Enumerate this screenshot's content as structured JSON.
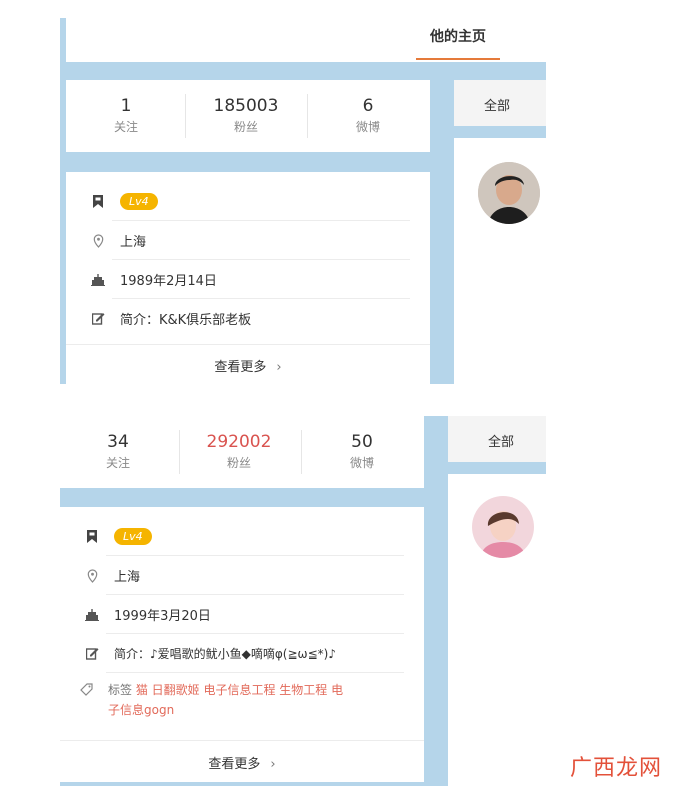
{
  "header": {
    "tab_home": "他的主页"
  },
  "profile1": {
    "stats": [
      {
        "num": "1",
        "label": "关注"
      },
      {
        "num": "185003",
        "label": "粉丝"
      },
      {
        "num": "6",
        "label": "微博"
      }
    ],
    "level": "Lv4",
    "location": "上海",
    "birthday": "1989年2月14日",
    "intro": "简介：K&K俱乐部老板",
    "more": "查看更多",
    "tab_all": "全部"
  },
  "profile2": {
    "stats": [
      {
        "num": "34",
        "label": "关注"
      },
      {
        "num": "292002",
        "label": "粉丝"
      },
      {
        "num": "50",
        "label": "微博"
      }
    ],
    "level": "Lv4",
    "location": "上海",
    "birthday": "1999年3月20日",
    "intro": "简介：♪爱唱歌的鱿小鱼◆嘀嘀φ(≧ω≦*)♪",
    "tags_label": "标签",
    "tags_line1": "猫 日翻歌姬 电子信息工程 生物工程 电",
    "tags_line2": "子信息gogn",
    "more": "查看更多",
    "tab_all": "全部"
  },
  "watermark": "广西龙网",
  "colors": {
    "accent": "#e57a3a",
    "panel_blue": "#b5d5ea",
    "badge": "#f5b400",
    "tag_red": "#e26a5a"
  }
}
